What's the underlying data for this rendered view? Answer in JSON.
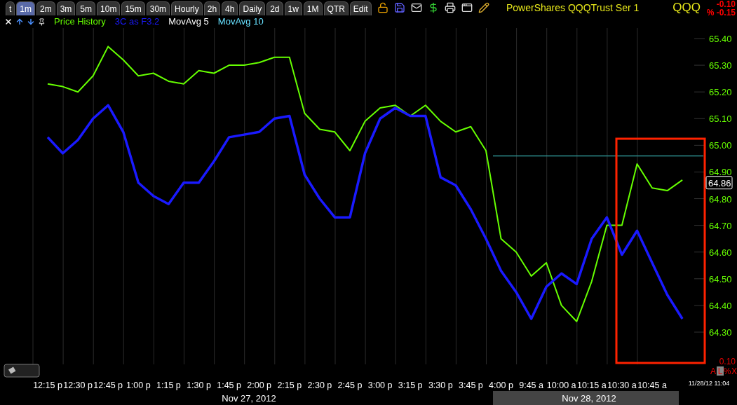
{
  "tabs": [
    {
      "label": "t",
      "selected": false
    },
    {
      "label": "1m",
      "selected": true
    },
    {
      "label": "2m",
      "selected": false
    },
    {
      "label": "3m",
      "selected": false
    },
    {
      "label": "5m",
      "selected": false
    },
    {
      "label": "10m",
      "selected": false
    },
    {
      "label": "15m",
      "selected": false
    },
    {
      "label": "30m",
      "selected": false
    },
    {
      "label": "Hourly",
      "selected": false
    },
    {
      "label": "2h",
      "selected": false
    },
    {
      "label": "4h",
      "selected": false
    },
    {
      "label": "Daily",
      "selected": false
    },
    {
      "label": "2d",
      "selected": false
    },
    {
      "label": "1w",
      "selected": false
    },
    {
      "label": "1M",
      "selected": false
    },
    {
      "label": "QTR",
      "selected": false
    },
    {
      "label": "Edit",
      "selected": false
    }
  ],
  "title": "PowerShares QQQTrust Ser 1",
  "symbol": "QQQ",
  "change": "-0.10",
  "change_percent": "% -0.15",
  "chart": {
    "moving_averages": [
      {
        "label": "MovAvg 5",
        "color": "#ffffff"
      },
      {
        "label": "MovAvg 10",
        "color": "#66e0ff"
      }
    ],
    "chart_data": {
      "type": "line",
      "categories": [
        "12:15 p",
        null,
        "12:30 p",
        null,
        "12:45 p",
        null,
        "1:00 p",
        null,
        "1:15 p",
        null,
        "1:30 p",
        null,
        "1:45 p",
        null,
        "2:00 p",
        null,
        "2:15 p",
        null,
        "2:30 p",
        null,
        "2:45 p",
        null,
        "3:00 p",
        null,
        "3:15 p",
        null,
        "3:30 p",
        null,
        "3:45 p",
        null,
        "4:00 p",
        null,
        "9:45 a",
        null,
        "10:00 a",
        null,
        "10:15 a",
        null,
        "10:30 a",
        null,
        "10:45 a",
        null,
        null
      ],
      "series": [
        {
          "name": "Price History",
          "color": "#66ff00",
          "values": [
            65.23,
            65.22,
            65.2,
            65.26,
            65.37,
            65.32,
            65.26,
            65.27,
            65.24,
            65.23,
            65.28,
            65.27,
            65.3,
            65.3,
            65.31,
            65.33,
            65.33,
            65.12,
            65.06,
            65.05,
            64.98,
            65.09,
            65.14,
            65.15,
            65.11,
            65.15,
            65.09,
            65.05,
            65.07,
            64.98,
            64.65,
            64.6,
            64.51,
            64.56,
            64.4,
            64.34,
            64.49,
            64.7,
            64.7,
            64.93,
            64.84,
            64.83,
            64.87
          ]
        },
        {
          "name": "3C as F3.2",
          "color": "#1a1aff",
          "values": [
            65.03,
            64.97,
            65.02,
            65.1,
            65.15,
            65.05,
            64.86,
            64.81,
            64.78,
            64.86,
            64.86,
            64.94,
            65.03,
            65.04,
            65.05,
            65.1,
            65.11,
            64.89,
            64.8,
            64.73,
            64.73,
            64.97,
            65.1,
            65.14,
            65.11,
            65.11,
            64.88,
            64.85,
            64.76,
            64.65,
            64.53,
            64.45,
            64.35,
            64.47,
            64.52,
            64.48,
            64.65,
            64.73,
            64.59,
            64.68,
            64.56,
            64.44,
            64.35
          ]
        }
      ],
      "ref_lines": [
        {
          "axis": "y",
          "value": 64.96
        }
      ],
      "grid": true,
      "ylim": [
        64.3,
        65.4
      ],
      "yticks": [
        {
          "value": 64.3,
          "label": "64.30"
        },
        {
          "value": 64.4,
          "label": "64.40"
        },
        {
          "value": 64.5,
          "label": "64.50"
        },
        {
          "value": 64.6,
          "label": "64.60"
        },
        {
          "value": 64.7,
          "label": "64.70"
        },
        {
          "value": 64.8,
          "label": "64.80"
        },
        {
          "value": 64.9,
          "label": "64.90"
        },
        {
          "value": 65.0,
          "label": "65.00"
        },
        {
          "value": 65.1,
          "label": "65.10"
        },
        {
          "value": 65.2,
          "label": "65.20"
        },
        {
          "value": 65.3,
          "label": "65.30"
        },
        {
          "value": 65.4,
          "label": "65.40"
        }
      ]
    },
    "last_price": "64.86",
    "scale_value": "0.10",
    "scale_buttons": [
      {
        "label": "A",
        "selected": false
      },
      {
        "label": "L",
        "selected": true
      },
      {
        "label": "%",
        "selected": false
      },
      {
        "label": "X",
        "selected": false
      }
    ],
    "timestamp": "11/28/12 11:04",
    "dates": [
      {
        "label": "Nov 27, 2012",
        "selected": false
      },
      {
        "label": "Nov 28, 2012",
        "selected": true
      }
    ]
  }
}
